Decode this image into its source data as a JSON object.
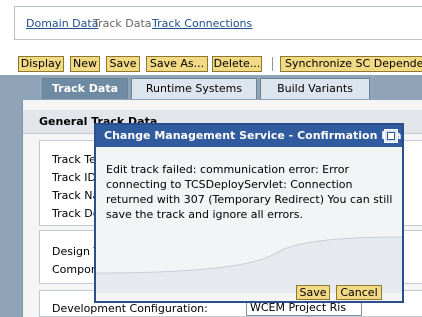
{
  "breadcrumb": {
    "items": [
      {
        "label": "Domain Data"
      },
      {
        "label": "Track Data"
      },
      {
        "label": "Track Connections"
      }
    ]
  },
  "toolbar": {
    "display": "Display",
    "new": "New",
    "save": "Save",
    "save_as": "Save As...",
    "delete": "Delete...",
    "synchronize": "Synchronize SC Dependencies"
  },
  "tabs": [
    {
      "label": "Track Data",
      "active": true
    },
    {
      "label": "Runtime Systems",
      "active": false
    },
    {
      "label": "Build Variants",
      "active": false
    }
  ],
  "section": {
    "title": "General Track Data"
  },
  "form": {
    "track_labels": [
      "Track Te",
      "Track ID",
      "Track Na",
      "Track De"
    ],
    "design_labels": [
      "Design T",
      "Compone"
    ],
    "dev_config_label": "Development Configuration:",
    "dev_config_value": "WCEM Project Ris"
  },
  "dialog": {
    "title": "Change Management Service - Confirmation Dial...",
    "message": "Edit track failed: communication error: Error connecting to TCSDeployServlet: Connection returned with 307 (Temporary Redirect) You can still save the track and ignore all errors.",
    "save_label": "Save",
    "cancel_label": "Cancel"
  },
  "colors": {
    "button_fill": "#f2d984",
    "dialog_title_bar": "#305b9e",
    "active_tab": "#6f8aa3"
  }
}
